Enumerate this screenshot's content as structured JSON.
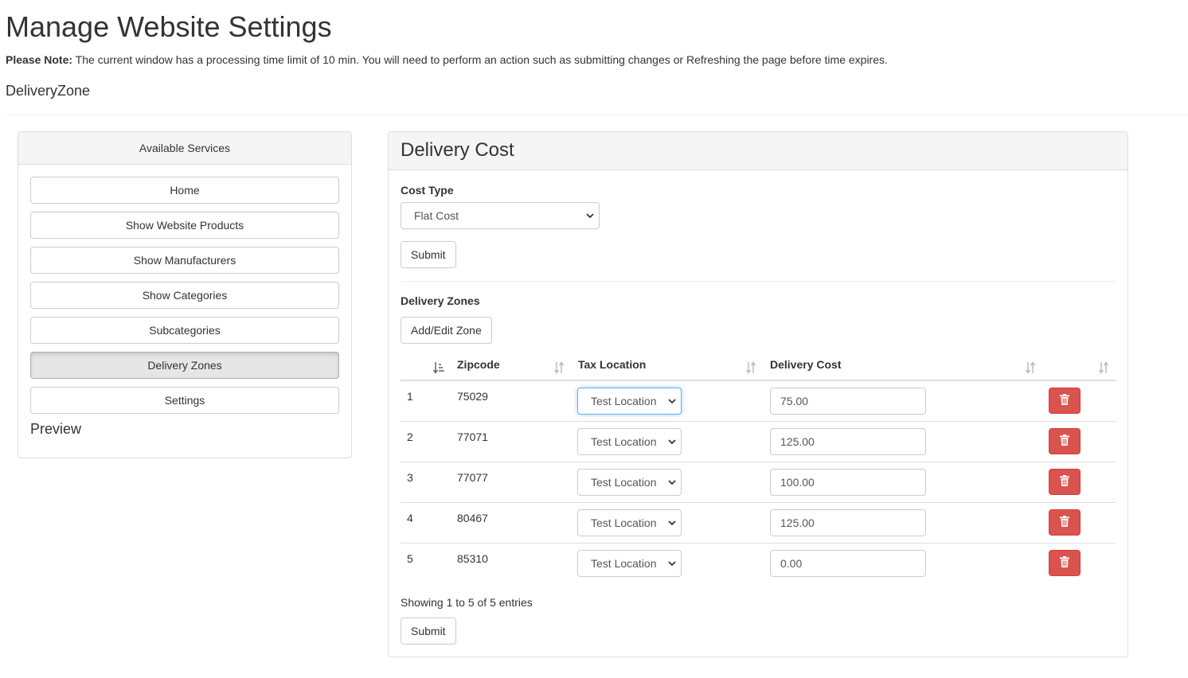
{
  "header": {
    "title": "Manage Website Settings",
    "note_bold": "Please Note:",
    "note_text": " The current window has a processing time limit of 10 min. You will need to perform an action such as submitting changes or Refreshing the page before time expires.",
    "section": "DeliveryZone"
  },
  "sidebar": {
    "heading": "Available Services",
    "items": [
      {
        "label": "Home"
      },
      {
        "label": "Show Website Products"
      },
      {
        "label": "Show Manufacturers"
      },
      {
        "label": "Show Categories"
      },
      {
        "label": "Subcategories"
      },
      {
        "label": "Delivery Zones",
        "active": true
      },
      {
        "label": "Settings"
      }
    ],
    "preview": "Preview"
  },
  "delivery_cost": {
    "heading": "Delivery Cost",
    "cost_type_label": "Cost Type",
    "cost_type_value": "Flat Cost",
    "submit_label": "Submit",
    "zones_label": "Delivery Zones",
    "add_edit_label": "Add/Edit Zone",
    "table": {
      "columns": [
        "",
        "Zipcode",
        "Tax Location",
        "Delivery Cost",
        ""
      ],
      "rows": [
        {
          "index": "1",
          "zipcode": "75029",
          "tax_location": "Test Location",
          "cost": "75.00"
        },
        {
          "index": "2",
          "zipcode": "77071",
          "tax_location": "Test Location",
          "cost": "125.00"
        },
        {
          "index": "3",
          "zipcode": "77077",
          "tax_location": "Test Location",
          "cost": "100.00"
        },
        {
          "index": "4",
          "zipcode": "80467",
          "tax_location": "Test Location",
          "cost": "125.00"
        },
        {
          "index": "5",
          "zipcode": "85310",
          "tax_location": "Test Location",
          "cost": "0.00"
        }
      ]
    },
    "entries_info": "Showing 1 to 5 of 5 entries",
    "bottom_submit_label": "Submit"
  },
  "icons": {
    "sort": "sort-icon",
    "sort_active": "sort-ascending-icon",
    "delete": "trash-icon",
    "dropdown": "chevron-down-icon"
  },
  "colors": {
    "danger": "#d9534f",
    "panel_heading": "#f5f5f5",
    "border": "#dddddd",
    "focus": "#66afe9"
  }
}
